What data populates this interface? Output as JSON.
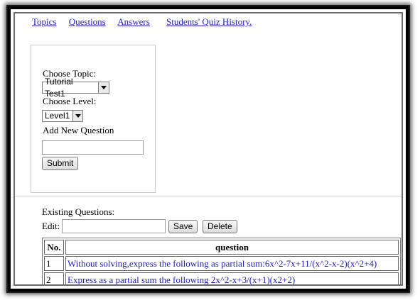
{
  "nav": {
    "topics": "Topics",
    "questions": "Questions",
    "answers": "Answers",
    "history": "Students' Quiz History."
  },
  "form": {
    "choose_topic_label": "Choose Topic:",
    "topic_selected": "Tutorial Test1",
    "choose_level_label": "Choose Level:",
    "level_selected": "Level1",
    "add_question_label": "Add New Question",
    "new_question_value": "",
    "submit_label": "Submit"
  },
  "existing": {
    "heading": "Existing Questions:",
    "edit_label": "Edit:",
    "edit_value": "",
    "save_label": "Save",
    "delete_label": "Delete"
  },
  "table": {
    "headers": [
      "No.",
      "question"
    ],
    "rows": [
      {
        "no": "1",
        "question": "Without solving,express the following as partial sum:6x^2-7x+11/(x^2-x-2)(x^2+4)"
      },
      {
        "no": "2",
        "question": "Express as a partial sum the following 2x^2-x+3/(x+1)(x2+2)"
      },
      {
        "no": "",
        "question": ""
      }
    ]
  },
  "colors": {
    "link": "#1f1fb8",
    "question_text": "#2020b8"
  }
}
